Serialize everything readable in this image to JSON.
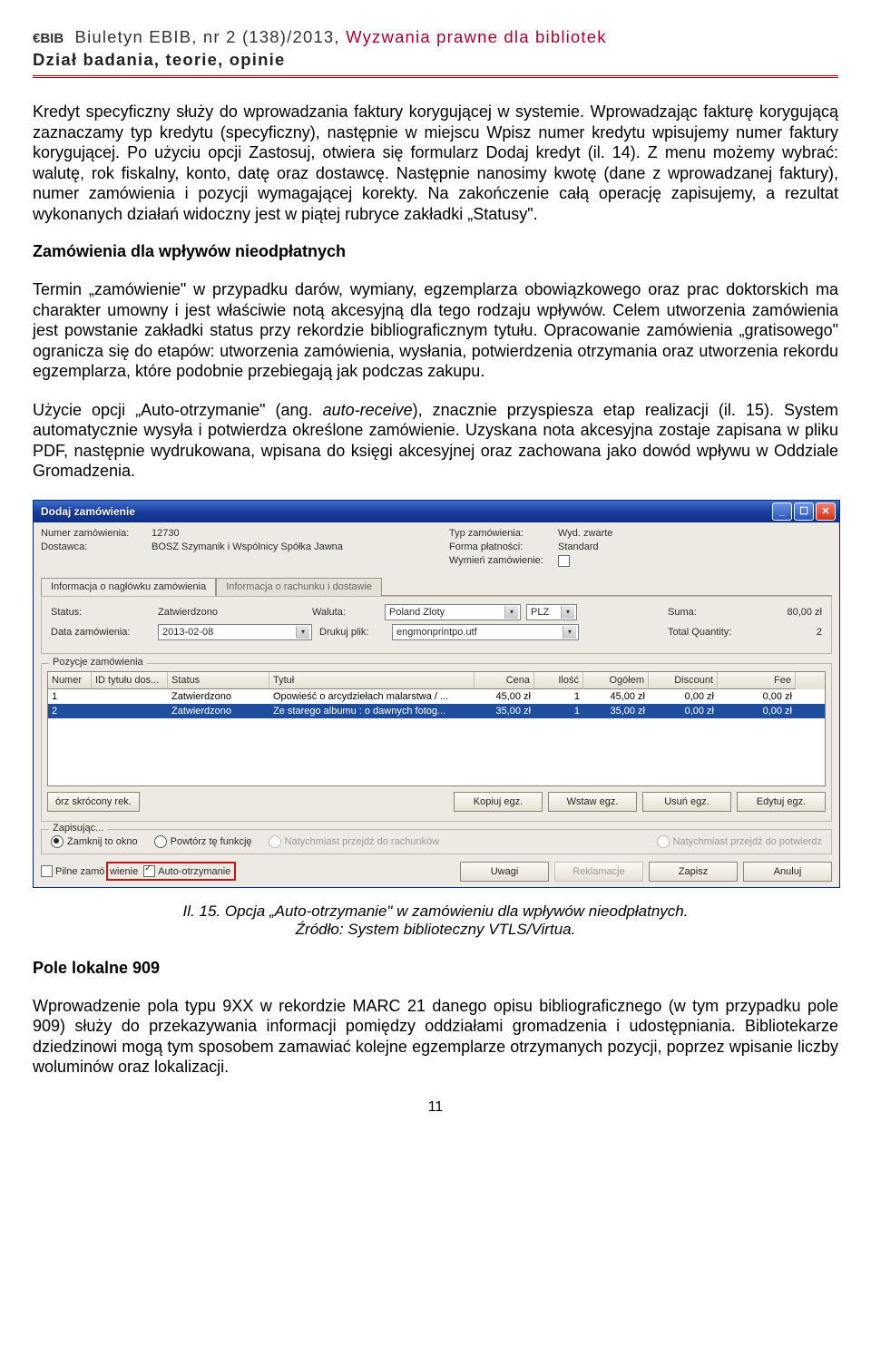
{
  "header": {
    "logo_text": "€BIB",
    "journal_prefix": "Biuletyn EBIB, nr 2 (138)/2013, ",
    "journal_red": "Wyzwania prawne dla bibliotek",
    "section": "Dział badania, teorie, opinie"
  },
  "para1": "Kredyt specyficzny służy do wprowadzania faktury korygującej w systemie. Wprowadzając fakturę korygującą zaznaczamy typ kredytu (specyficzny), następnie w miejscu Wpisz numer kredytu wpisujemy numer faktury korygującej. Po użyciu opcji Zastosuj, otwiera się formularz Dodaj kredyt (il. 14). Z menu możemy wybrać: walutę, rok fiskalny, konto, datę oraz dostawcę. Następnie nanosimy kwotę (dane z wprowadzanej faktury), numer zamówienia i pozycji wymagającej korekty. Na zakończenie całą operację zapisujemy, a rezultat wykonanych działań widoczny jest w piątej rubryce zakładki „Statusy\".",
  "h1": "Zamówienia dla wpływów nieodpłatnych",
  "para2": "Termin „zamówienie\" w przypadku darów, wymiany, egzemplarza obowiązkowego oraz prac doktorskich ma charakter umowny i jest właściwie notą akcesyjną dla tego rodzaju wpływów. Celem utworzenia zamówienia jest powstanie zakładki status przy rekordzie bibliograficznym tytułu. Opracowanie zamówienia „gratisowego\" ogranicza się do etapów: utworzenia zamówienia, wysłania, potwierdzenia otrzymania oraz utworzenia rekordu egzemplarza, które podobnie przebiegają jak podczas zakupu.",
  "para3a": "Użycie opcji „Auto-otrzymanie\" (ang. ",
  "para3b": "auto-receive",
  "para3c": "), znacznie przyspiesza etap realizacji (il. 15). System automatycznie wysyła i potwierdza określone zamówienie. Uzyskana nota akcesyjna zostaje zapisana w pliku PDF, następnie wydrukowana, wpisana do księgi akcesyjnej oraz zachowana jako dowód wpływu w Oddziale Gromadzenia.",
  "fig": {
    "line1": "Il. 15. Opcja „Auto-otrzymanie\" w zamówieniu dla wpływów nieodpłatnych.",
    "line2": "Źródło: System biblioteczny VTLS/Virtua."
  },
  "h2": "Pole lokalne 909",
  "para4": "Wprowadzenie pola typu 9XX w rekordzie MARC 21 danego opisu bibliograficznego (w tym przypadku pole 909) służy do przekazywania informacji pomiędzy oddziałami gromadzenia i udostępniania. Bibliotekarze dziedzinowi mogą tym sposobem zamawiać kolejne egzemplarze otrzymanych pozycji, poprzez wpisanie liczby woluminów oraz lokalizacji.",
  "page_num": "11",
  "win": {
    "title": "Dodaj zamówienie",
    "top_left": {
      "numer_label": "Numer zamówienia:",
      "numer_val": "12730",
      "dostawca_label": "Dostawca:",
      "dostawca_val": "BOSZ Szymanik i Wspólnicy Spółka Jawna"
    },
    "top_right": {
      "typ_label": "Typ zamówienia:",
      "typ_val": "Wyd. zwarte",
      "forma_label": "Forma płatności:",
      "forma_val": "Standard",
      "wymien_label": "Wymień zamówienie:"
    },
    "tabs": {
      "tab1": "Informacja o nagłówku zamówienia",
      "tab2": "Informacja o rachunku i dostawie"
    },
    "panel": {
      "status_label": "Status:",
      "status_val": "Zatwierdzono",
      "waluta_label": "Waluta:",
      "waluta_val": "Poland Zloty",
      "waluta_code": "PLZ",
      "suma_label": "Suma:",
      "suma_val": "80,00 zł",
      "data_label": "Data zamówienia:",
      "data_val": "2013-02-08",
      "drukuj_label": "Drukuj plik:",
      "drukuj_val": "engmonprintpo.utf",
      "totalq_label": "Total Quantity:",
      "totalq_val": "2"
    },
    "pozycje_legend": "Pozycje zamówienia",
    "grid_headers": {
      "numer": "Numer",
      "id": "ID tytułu dos...",
      "status": "Status",
      "tytul": "Tytuł",
      "cena": "Cena",
      "ilosc": "Ilość",
      "ogolem": "Ogółem",
      "discount": "Discount",
      "fee": "Fee"
    },
    "rows": [
      {
        "numer": "1",
        "id": "",
        "status": "Zatwierdzono",
        "tytul": "Opowieść o arcydziełach malarstwa / ...",
        "cena": "45,00 zł",
        "ilosc": "1",
        "ogolem": "45,00 zł",
        "discount": "0,00 zł",
        "fee": "0,00 zł"
      },
      {
        "numer": "2",
        "id": "",
        "status": "Zatwierdzono",
        "tytul": "Ze starego albumu : o dawnych fotog...",
        "cena": "35,00 zł",
        "ilosc": "1",
        "ogolem": "35,00 zł",
        "discount": "0,00 zł",
        "fee": "0,00 zł"
      }
    ],
    "buttons": {
      "skroc": "órz skrócony rek.",
      "kopiuj": "Kopiuj egz.",
      "wstaw": "Wstaw egz.",
      "usun": "Usuń egz.",
      "edytuj": "Edytuj egz.",
      "uwagi": "Uwagi",
      "reklam": "Reklamacje",
      "zapisz": "Zapisz",
      "anuluj": "Anuluj"
    },
    "zapisujac": {
      "legend": "Zapisując...",
      "opt1": "Zamknij to okno",
      "opt2": "Powtórz tę funkcję",
      "dis1": "Natychmiast przejdź do rachunków",
      "dis2": "Natychmiast przejdź do potwierdz"
    },
    "bottom": {
      "pilne": "Pilne zamówienie",
      "auto": "Auto-otrzymanie"
    }
  }
}
